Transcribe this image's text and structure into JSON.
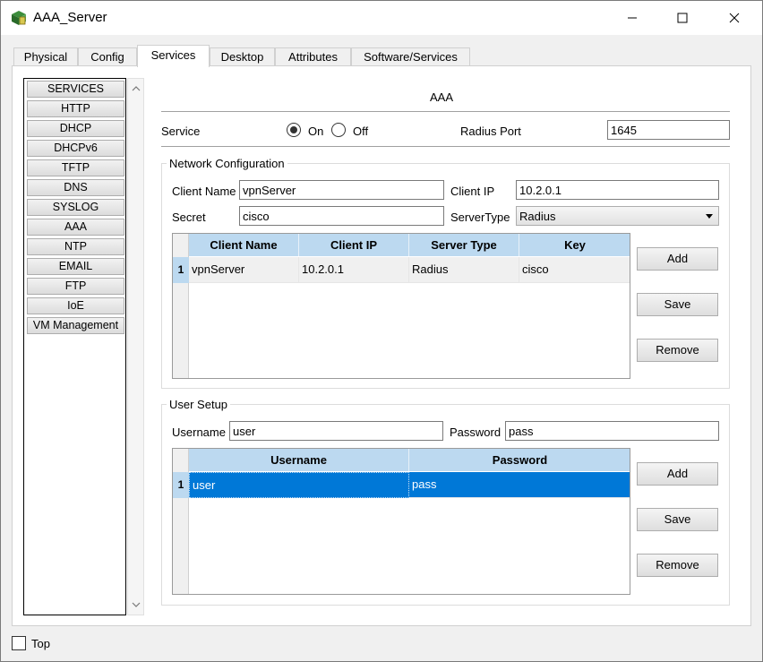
{
  "window": {
    "title": "AAA_Server",
    "icons": {
      "app": "packet-tracer-server-icon",
      "minimize": "minimize-icon",
      "maximize": "maximize-icon",
      "close": "close-icon"
    }
  },
  "tabs": [
    {
      "label": "Physical",
      "active": false
    },
    {
      "label": "Config",
      "active": false
    },
    {
      "label": "Services",
      "active": true
    },
    {
      "label": "Desktop",
      "active": false
    },
    {
      "label": "Attributes",
      "active": false
    },
    {
      "label": "Software/Services",
      "active": false
    }
  ],
  "sidebar": {
    "items": [
      "SERVICES",
      "HTTP",
      "DHCP",
      "DHCPv6",
      "TFTP",
      "DNS",
      "SYSLOG",
      "AAA",
      "NTP",
      "EMAIL",
      "FTP",
      "IoE",
      "VM Management"
    ]
  },
  "aaa": {
    "heading": "AAA",
    "service_label": "Service",
    "on_label": "On",
    "off_label": "Off",
    "service_state": "On",
    "radius_port_label": "Radius Port",
    "radius_port_value": "1645"
  },
  "network_config": {
    "title": "Network Configuration",
    "client_name_label": "Client Name",
    "client_name_value": "vpnServer",
    "client_ip_label": "Client IP",
    "client_ip_value": "10.2.0.1",
    "secret_label": "Secret",
    "secret_value": "cisco",
    "server_type_label": "ServerType",
    "server_type_value": "Radius",
    "table": {
      "columns": [
        "Client Name",
        "Client IP",
        "Server Type",
        "Key"
      ],
      "rows": [
        {
          "num": "1",
          "cells": [
            "vpnServer",
            "10.2.0.1",
            "Radius",
            "cisco"
          ]
        }
      ]
    },
    "buttons": {
      "add": "Add",
      "save": "Save",
      "remove": "Remove"
    }
  },
  "user_setup": {
    "title": "User Setup",
    "username_label": "Username",
    "username_value": "user",
    "password_label": "Password",
    "password_value": "pass",
    "table": {
      "columns": [
        "Username",
        "Password"
      ],
      "rows": [
        {
          "num": "1",
          "cells": [
            "user",
            "pass"
          ],
          "selected": true
        }
      ]
    },
    "buttons": {
      "add": "Add",
      "save": "Save",
      "remove": "Remove"
    }
  },
  "footer": {
    "top_label": "Top",
    "top_checked": false
  },
  "colors": {
    "header_blue": "#bcd9f0",
    "selection_blue": "#0078d7"
  }
}
